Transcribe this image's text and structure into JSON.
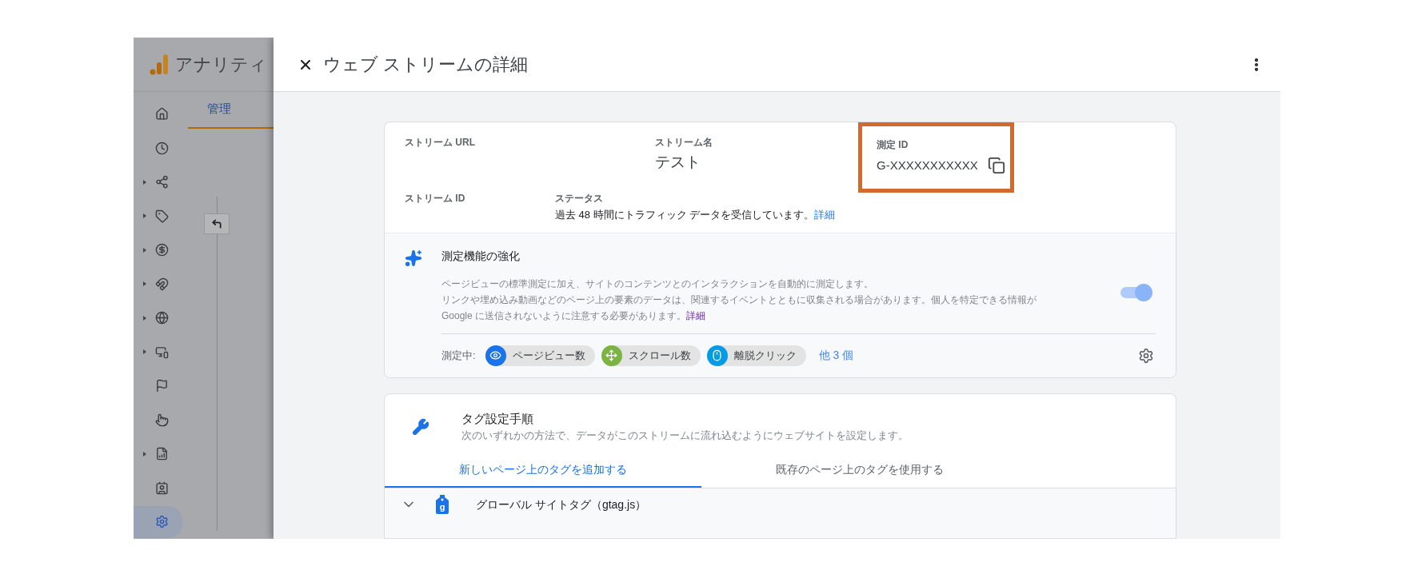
{
  "background_app": {
    "app_name": "アナリティ",
    "tab": {
      "label": "管理",
      "selected": true
    },
    "nav_items": [
      {
        "expandable": false,
        "selected": false
      },
      {
        "expandable": false,
        "selected": false
      },
      {
        "expandable": true,
        "selected": false
      },
      {
        "expandable": true,
        "selected": false
      },
      {
        "expandable": true,
        "selected": false
      },
      {
        "expandable": true,
        "selected": false
      },
      {
        "expandable": true,
        "selected": false
      },
      {
        "expandable": true,
        "selected": false
      },
      {
        "expandable": false,
        "selected": false
      },
      {
        "expandable": false,
        "selected": false
      },
      {
        "expandable": true,
        "selected": false
      },
      {
        "expandable": false,
        "selected": false
      },
      {
        "expandable": false,
        "selected": true
      }
    ]
  },
  "panel": {
    "title": "ウェブ ストリームの詳細",
    "stream_details": {
      "stream_url": {
        "label": "ストリーム URL"
      },
      "stream_name": {
        "label": "ストリーム名",
        "value": "テスト"
      },
      "measurement_id": {
        "label": "測定 ID",
        "value": "G-XXXXXXXXXXX",
        "highlighted": true
      },
      "stream_id": {
        "label": "ストリーム ID"
      },
      "status": {
        "label": "ステータス",
        "text": "過去 48 時間にトラフィック データを受信しています。",
        "link": "詳細"
      }
    },
    "enhanced_measurement": {
      "title": "測定機能の強化",
      "description": [
        "ページビューの標準測定に加え、サイトのコンテンツとのインタラクションを自動的に測定します。",
        "リンクや埋め込み動画などのページ上の要素のデータは、関連するイベントとともに収集される場合があります。個人を特定できる情報が Google に送信されないように注意する必要があります。"
      ],
      "link": "詳細",
      "on": true,
      "measuring_label": "測定中:",
      "chips": [
        {
          "kind": "eye",
          "label": "ページビュー数",
          "color": "#1a73e8"
        },
        {
          "kind": "scroll",
          "label": "スクロール数",
          "color": "#7cb342"
        },
        {
          "kind": "mouse",
          "label": "離脱クリック",
          "color": "#039be5"
        }
      ],
      "more": "他 3 個"
    },
    "tagging": {
      "title": "タグ設定手順",
      "subtitle": "次のいずれかの方法で、データがこのストリームに流れ込むようにウェブサイトを設定します。",
      "tabs": [
        {
          "label": "新しいページ上のタグを追加する",
          "selected": true
        },
        {
          "label": "既存のページ上のタグを使用する",
          "selected": false
        }
      ],
      "row": {
        "tag_letter": "g",
        "label": "グローバル サイトタグ（gtag.js）",
        "expanded": false
      }
    }
  }
}
